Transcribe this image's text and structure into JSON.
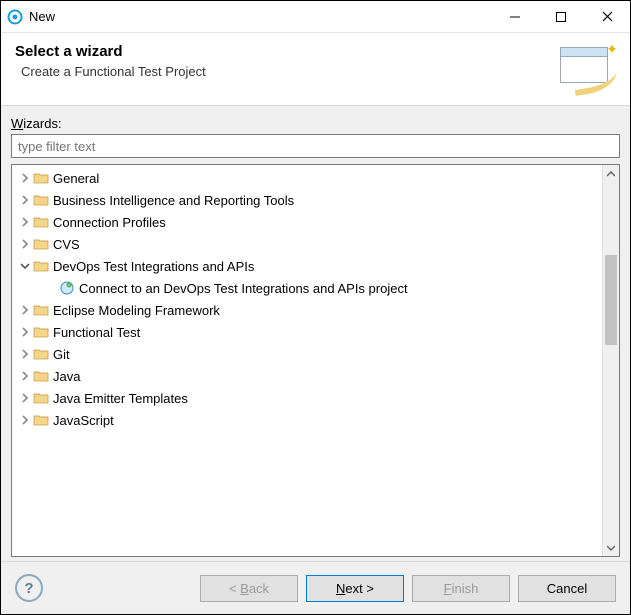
{
  "titlebar": {
    "title": "New"
  },
  "banner": {
    "title": "Select a wizard",
    "subtitle": "Create a Functional Test Project"
  },
  "filter": {
    "label_pre": "",
    "label_mn": "W",
    "label_post": "izards:",
    "placeholder": "type filter text"
  },
  "tree": {
    "items": [
      {
        "label": "General",
        "expanded": false
      },
      {
        "label": "Business Intelligence and Reporting Tools",
        "expanded": false
      },
      {
        "label": "Connection Profiles",
        "expanded": false
      },
      {
        "label": "CVS",
        "expanded": false
      },
      {
        "label": "DevOps Test Integrations and APIs",
        "expanded": true,
        "children": [
          {
            "label": "Connect to an DevOps Test Integrations and APIs project"
          }
        ]
      },
      {
        "label": "Eclipse Modeling Framework",
        "expanded": false
      },
      {
        "label": "Functional Test",
        "expanded": false
      },
      {
        "label": "Git",
        "expanded": false
      },
      {
        "label": "Java",
        "expanded": false
      },
      {
        "label": "Java Emitter Templates",
        "expanded": false
      },
      {
        "label": "JavaScript",
        "expanded": false
      }
    ]
  },
  "buttons": {
    "back": {
      "label_pre": "< ",
      "label_mn": "B",
      "label_post": "ack"
    },
    "next": {
      "label_mn": "N",
      "label_post": "ext >"
    },
    "finish": {
      "label_mn": "F",
      "label_post": "inish"
    },
    "cancel": {
      "label": "Cancel"
    }
  }
}
